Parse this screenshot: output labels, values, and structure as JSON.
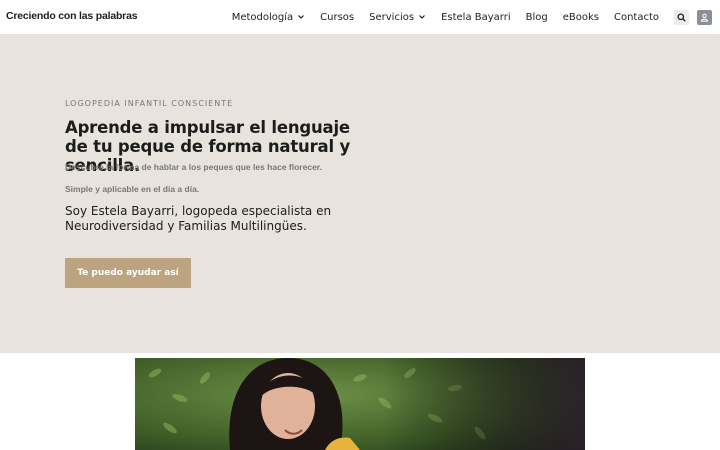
{
  "header": {
    "logo": "Creciendo con las palabras",
    "nav": [
      {
        "label": "Metodología",
        "has_dropdown": true
      },
      {
        "label": "Cursos",
        "has_dropdown": false
      },
      {
        "label": "Servicios",
        "has_dropdown": true
      },
      {
        "label": "Estela Bayarri",
        "has_dropdown": false
      },
      {
        "label": "Blog",
        "has_dropdown": false
      },
      {
        "label": "eBooks",
        "has_dropdown": false
      },
      {
        "label": "Contacto",
        "has_dropdown": false
      }
    ],
    "icons": [
      "search-icon",
      "user-icon"
    ]
  },
  "hero": {
    "eyebrow": "LOGOPEDIA INFANTIL CONSCIENTE",
    "headline": "Aprende a impulsar el lenguaje de tu peque de forma natural y sencilla.",
    "sub1": "Descubre la forma de hablar a los peques que les hace florecer.",
    "sub2": "Simple y aplicable en el día a día.",
    "intro": "Soy Estela Bayarri, logopeda especialista en Neurodiversidad y Familias Multilingües.",
    "cta_label": "Te puedo ayudar así"
  },
  "colors": {
    "hero_bg": "#e8e4dd",
    "cta_bg": "#bba47f",
    "text_dark": "#1c1c1c",
    "text_muted": "#777777"
  }
}
